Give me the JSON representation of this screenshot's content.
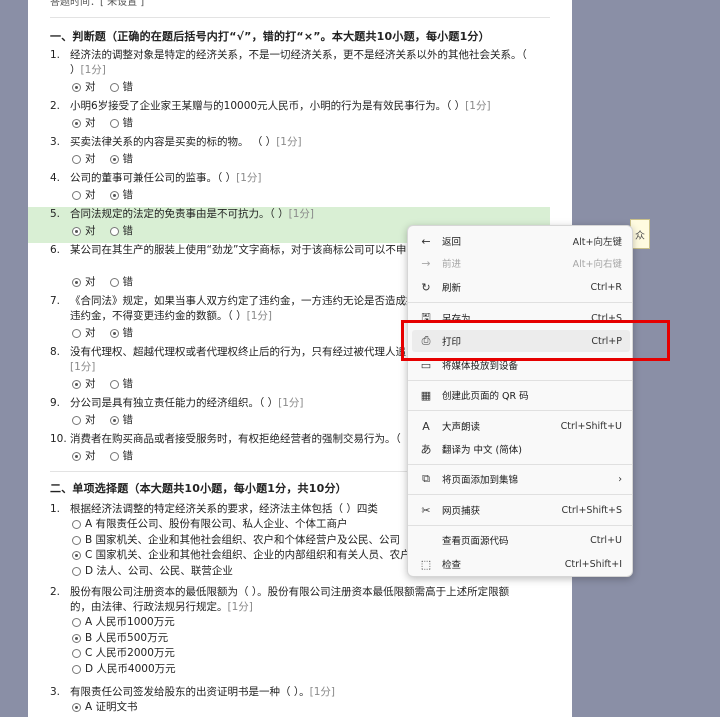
{
  "page": {
    "answer_time": "答题时间：[ 未设置 ]",
    "section1_title": "一、判断题（正确的在题后括号内打“√”，错的打“×”。本大题共10小题，每小题1分）",
    "section2_title": "二、单项选择题（本大题共10小题，每小题1分，共10分）",
    "true_label": "对",
    "false_label": "错",
    "tf_questions": [
      {
        "num": "1.",
        "text": "经济法的调整对象是特定的经济关系，不是一切经济关系，更不是经济关系以外的其他社会关系。（",
        "text2": "）",
        "score": "[1分]"
      },
      {
        "num": "2.",
        "text": "小明6岁接受了企业家王某赠与的10000元人民币，小明的行为是有效民事行为。（     ）",
        "score": "[1分]"
      },
      {
        "num": "3.",
        "text": "买卖法律关系的内容是买卖的标的物。      （          ）",
        "score": "[1分]"
      },
      {
        "num": "4.",
        "text": "公司的董事可兼任公司的监事。（    ）",
        "score": "[1分]"
      },
      {
        "num": "5.",
        "text": "合同法规定的法定的免责事由是不可抗力。（    ）",
        "score": "[1分]"
      },
      {
        "num": "6.",
        "text": "某公司在其生产的服装上使用“劲龙”文字商标，对于该商标公司可以不申",
        "score": ""
      },
      {
        "num": "7.",
        "text": "《合同法》规定，如果当事人双方约定了违约金，一方违约无论是否造成损",
        "text2": "违约金，不得变更违约金的数额。（      ）",
        "score": "[1分]"
      },
      {
        "num": "8.",
        "text": "没有代理权、超越代理权或者代理权终止后的行为，只有经过被代理人追",
        "score": "[1分]"
      },
      {
        "num": "9.",
        "text": "分公司是具有独立责任能力的经济组织。（          ）",
        "score": "[1分]"
      },
      {
        "num": "10.",
        "text": "消费者在购买商品或者接受服务时，有权拒绝经营者的强制交易行为。（",
        "score": ""
      }
    ],
    "mc_questions": [
      {
        "num": "1.",
        "text": "根据经济法调整的特定经济关系的要求，经济法主体包括（          ）四类",
        "options": [
          "A  有限责任公司、股份有限公司、私人企业、个体工商户",
          "B  国家机关、企业和其他社会组织、农户和个体经营户及公民、公司",
          "C  国家机关、企业和其他社会组织、企业的内部组织和有关人员、农户",
          "D  法人、公司、公民、联营企业"
        ]
      },
      {
        "num": "2.",
        "text": "股份有限公司注册资本的最低限额为（          ）。股份有限公司注册资本最低限额需高于上述所定限额",
        "text2": "的，由法律、行政法规另行规定。",
        "score": "[1分]",
        "options": [
          "A  人民币1000万元",
          "B  人民币500万元",
          "C  人民币2000万元",
          "D  人民币4000万元"
        ]
      },
      {
        "num": "3.",
        "text": "有限责任公司签发给股东的出资证明书是一种（            ）。",
        "score": "[1分]",
        "options": [
          "A  证明文书"
        ]
      }
    ]
  },
  "context_menu": {
    "items": [
      {
        "icon": "←",
        "label": "返回",
        "shortcut": "Alt+向左键"
      },
      {
        "icon": "→",
        "label": "前进",
        "shortcut": "Alt+向右键"
      },
      {
        "icon": "↻",
        "label": "刷新",
        "shortcut": "Ctrl+R"
      },
      {
        "icon": "🖫",
        "label": "另存为",
        "shortcut": "Ctrl+S"
      },
      {
        "icon": "⎙",
        "label": "打印",
        "shortcut": "Ctrl+P"
      },
      {
        "icon": "▭",
        "label": "将媒体投放到设备",
        "shortcut": ""
      },
      {
        "icon": "▦",
        "label": "创建此页面的 QR 码",
        "shortcut": ""
      },
      {
        "icon": "A",
        "label": "大声朗读",
        "shortcut": "Ctrl+Shift+U"
      },
      {
        "icon": "あ",
        "label": "翻译为 中文 (简体)",
        "shortcut": ""
      },
      {
        "icon": "⧉",
        "label": "将页面添加到集锦",
        "shortcut": "›"
      },
      {
        "icon": "✂",
        "label": "网页捕获",
        "shortcut": "Ctrl+Shift+S"
      },
      {
        "icon": "",
        "label": "查看页面源代码",
        "shortcut": "Ctrl+U"
      },
      {
        "icon": "⬚",
        "label": "检查",
        "shortcut": "Ctrl+Shift+I"
      }
    ]
  },
  "tooltip_fragment": "众"
}
